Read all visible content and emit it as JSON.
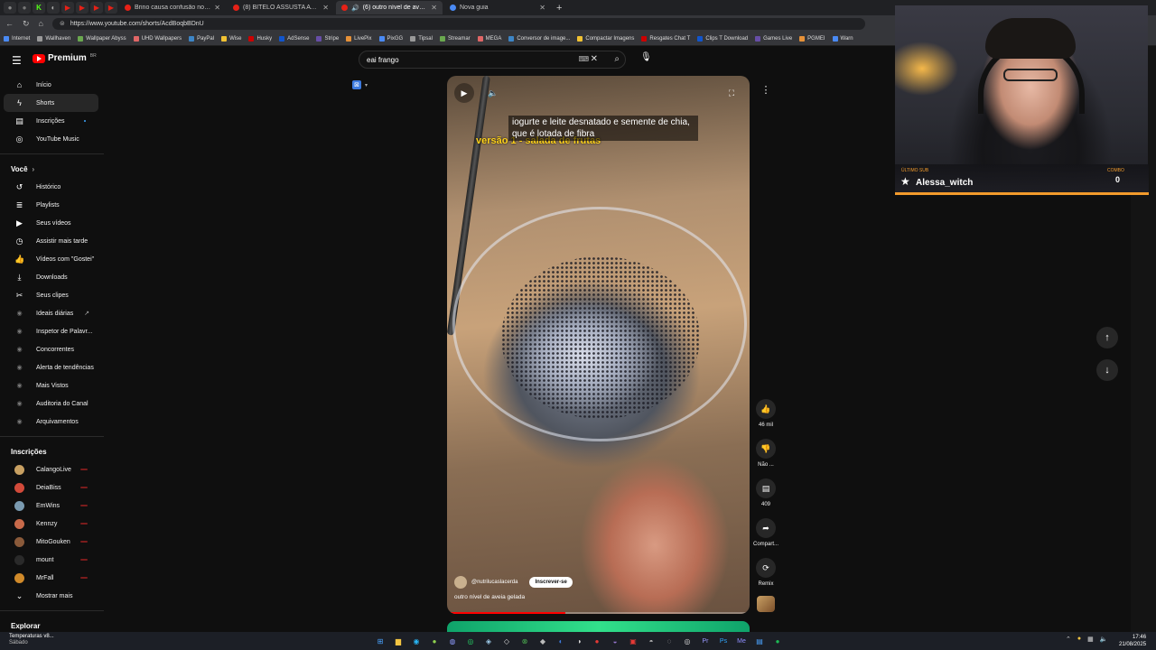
{
  "browser": {
    "tabs": [
      {
        "label": "Brino causa confusão no Rodi...",
        "active": false,
        "icon": "youtube-icon"
      },
      {
        "label": "(8) BITELO ASSUSTA ATENDENTE...",
        "active": false,
        "icon": "youtube-icon"
      },
      {
        "label": "(6) outro nível de aveia gela...",
        "active": true,
        "icon": "youtube-icon"
      },
      {
        "label": "Nova guia",
        "active": false,
        "icon": "newtab-icon"
      }
    ],
    "url": "https://www.youtube.com/shorts/AcdBoqbBDnU",
    "bookmarks": [
      "Internet",
      "Wallhaven",
      "Wallpaper Abyss",
      "UHD Wallpapers",
      "PayPal",
      "Wise",
      "Husky",
      "AdSense",
      "Stripe",
      "LivePix",
      "PixGG",
      "Tipsal",
      "Streamar",
      "MEGA",
      "Conversor de image...",
      "Compactar Imagens",
      "Resgates Chat T",
      "Clips T Download",
      "Games Live",
      "PGMEI",
      "Warn"
    ]
  },
  "header": {
    "logo_text": "Premium",
    "logo_region": "BR",
    "search_value": "eai frango"
  },
  "sidebar": {
    "primary": [
      {
        "label": "Início",
        "icon": "home-icon"
      },
      {
        "label": "Shorts",
        "icon": "shorts-icon",
        "active": true
      },
      {
        "label": "Inscrições",
        "icon": "subscriptions-icon",
        "badge": true
      },
      {
        "label": "YouTube Music",
        "icon": "youtube-music-icon"
      }
    ],
    "you_heading": "Você",
    "you": [
      {
        "label": "Histórico",
        "icon": "history-icon"
      },
      {
        "label": "Playlists",
        "icon": "playlists-icon"
      },
      {
        "label": "Seus vídeos",
        "icon": "your-videos-icon"
      },
      {
        "label": "Assistir mais tarde",
        "icon": "watch-later-icon"
      },
      {
        "label": "Vídeos com \"Gostei\"",
        "icon": "liked-videos-icon"
      },
      {
        "label": "Downloads",
        "icon": "download-icon"
      },
      {
        "label": "Seus clipes",
        "icon": "clips-icon"
      },
      {
        "label": "Ideais diárias",
        "icon": "extension-icon",
        "external": true
      },
      {
        "label": "Inspetor de Palavr...",
        "icon": "extension-icon"
      },
      {
        "label": "Concorrentes",
        "icon": "extension-icon"
      },
      {
        "label": "Alerta de tendências",
        "icon": "extension-icon"
      },
      {
        "label": "Mais Vistos",
        "icon": "extension-icon"
      },
      {
        "label": "Auditoria do Canal",
        "icon": "extension-icon"
      },
      {
        "label": "Arquivamentos",
        "icon": "extension-icon"
      }
    ],
    "subs_heading": "Inscrições",
    "subs": [
      {
        "label": "CalangoLive",
        "color": "#c8a062"
      },
      {
        "label": "DeiaBiss",
        "color": "#d24a3a"
      },
      {
        "label": "EmWins",
        "color": "#7a9ab0"
      },
      {
        "label": "Kennzy",
        "color": "#c86a4a"
      },
      {
        "label": "MitoGouken",
        "color": "#8a5a3a"
      },
      {
        "label": "mount",
        "color": "#2a2a2a"
      },
      {
        "label": "MrFall",
        "color": "#d08a2a"
      }
    ],
    "show_more": "Mostrar mais",
    "explore_heading": "Explorar"
  },
  "short": {
    "caption": "iogurte e leite desnatado e semente de chia, que é lotada de fibra",
    "overlay_title": "versão 1 - salada de frutas",
    "channel": "@nutrilucaslacerda",
    "subscribe": "Inscrever-se",
    "title": "outro nível de aveia gelada",
    "progress": 0.39
  },
  "actions": [
    {
      "name": "like",
      "icon": "thumbs-up-icon",
      "label": "46 mil"
    },
    {
      "name": "dislike",
      "icon": "thumbs-down-icon",
      "label": "Não ..."
    },
    {
      "name": "comments",
      "icon": "comment-icon",
      "label": "409"
    },
    {
      "name": "share",
      "icon": "share-icon",
      "label": "Compart..."
    },
    {
      "name": "remix",
      "icon": "remix-icon",
      "label": "Remix"
    }
  ],
  "webcam": {
    "last_sub_label": "ÚLTIMO SUB",
    "last_sub_name": "Alessa_witch",
    "combo_label": "COMBO",
    "combo_count": "0",
    "accent": "#f29b2c"
  },
  "taskbar": {
    "weather_title": "Temperaturas v8...",
    "weather_sub": "Sábado",
    "time": "17:46",
    "date": "21/08/2025"
  }
}
